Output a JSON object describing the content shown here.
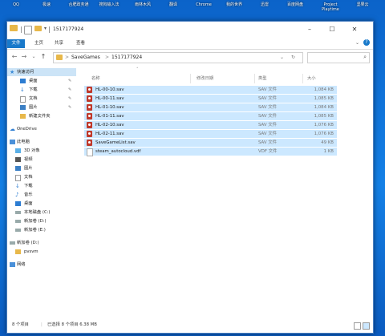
{
  "desktop": {
    "icons": [
      "QQ",
      "极速",
      "合肥政务通",
      "搜狗输入法",
      "雨林木风",
      "翻译",
      "Chrome",
      "我的世界",
      "迅雷",
      "百度网盘",
      "Project Playtime",
      "坚果云"
    ]
  },
  "window": {
    "title": "1517177924",
    "qat": {
      "down_arrow": "▾"
    }
  },
  "ribbon": {
    "tabs": [
      "文件",
      "主页",
      "共享",
      "查看"
    ]
  },
  "address": {
    "back": "←",
    "forward": "→",
    "recent": "⌄",
    "up": "↑",
    "crumbs": [
      "SaveGames",
      "1517177924"
    ],
    "separator": ">",
    "dropdown": "⌄",
    "refresh": "↻"
  },
  "nav": {
    "quick_access": "快速访问",
    "quick_items": [
      "桌面",
      "下载",
      "文档",
      "图片",
      "新建文件夹"
    ],
    "onedrive": "OneDrive",
    "this_pc": "此电脑",
    "pc_items": [
      "3D 对象",
      "视频",
      "图片",
      "文档",
      "下载",
      "音乐",
      "桌面",
      "本地磁盘 (C:)",
      "新加卷 (D:)",
      "新加卷 (E:)"
    ],
    "drive_d": "新加卷 (D:)",
    "drive_d_items": [
      "pvsvm"
    ],
    "network": "网络"
  },
  "files": {
    "columns": [
      "名称",
      "修改日期",
      "类型",
      "大小"
    ],
    "rows": [
      {
        "name": "HL-00-10.sav",
        "type": "SAV 文件",
        "size": "1,084 KB",
        "icon": "sav",
        "selected": true
      },
      {
        "name": "HL-00-11.sav",
        "type": "SAV 文件",
        "size": "1,085 KB",
        "icon": "sav",
        "selected": true
      },
      {
        "name": "HL-01-10.sav",
        "type": "SAV 文件",
        "size": "1,084 KB",
        "icon": "sav",
        "selected": true
      },
      {
        "name": "HL-01-11.sav",
        "type": "SAV 文件",
        "size": "1,085 KB",
        "icon": "sav",
        "selected": true
      },
      {
        "name": "HL-02-10.sav",
        "type": "SAV 文件",
        "size": "1,076 KB",
        "icon": "sav",
        "selected": true
      },
      {
        "name": "HL-02-11.sav",
        "type": "SAV 文件",
        "size": "1,076 KB",
        "icon": "sav",
        "selected": true
      },
      {
        "name": "SaveGameList.sav",
        "type": "SAV 文件",
        "size": "49 KB",
        "icon": "sav",
        "selected": true
      },
      {
        "name": "steam_autocloud.vdf",
        "type": "VDF 文件",
        "size": "1 KB",
        "icon": "vdf",
        "selected": true
      }
    ]
  },
  "status": {
    "count": "8 个项目",
    "selected": "已选择 8 个项目 6.38 MB"
  },
  "colors": {
    "accent": "#1979ca",
    "selection": "#cce8ff",
    "desktop": "#0b63c9"
  }
}
